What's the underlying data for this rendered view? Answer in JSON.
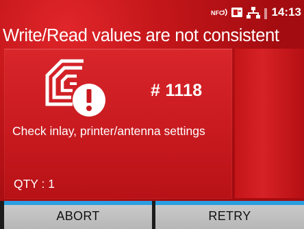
{
  "status_bar": {
    "icons": [
      "nfc-icon",
      "card-icon",
      "lan-icon",
      "signal-icon"
    ],
    "time": "14:13"
  },
  "title": "Write/Read values are not consistent",
  "error": {
    "icon": "rfid-error-icon",
    "code": "# 1118",
    "message": "Check inlay, printer/antenna settings",
    "qty": "QTY : 1"
  },
  "buttons": {
    "abort": "ABORT",
    "retry": "RETRY"
  },
  "colors": {
    "background": "#c3161a",
    "panel": "#d8262b",
    "button": "#c2c2c2",
    "button_accent": "#2a9ee0"
  }
}
